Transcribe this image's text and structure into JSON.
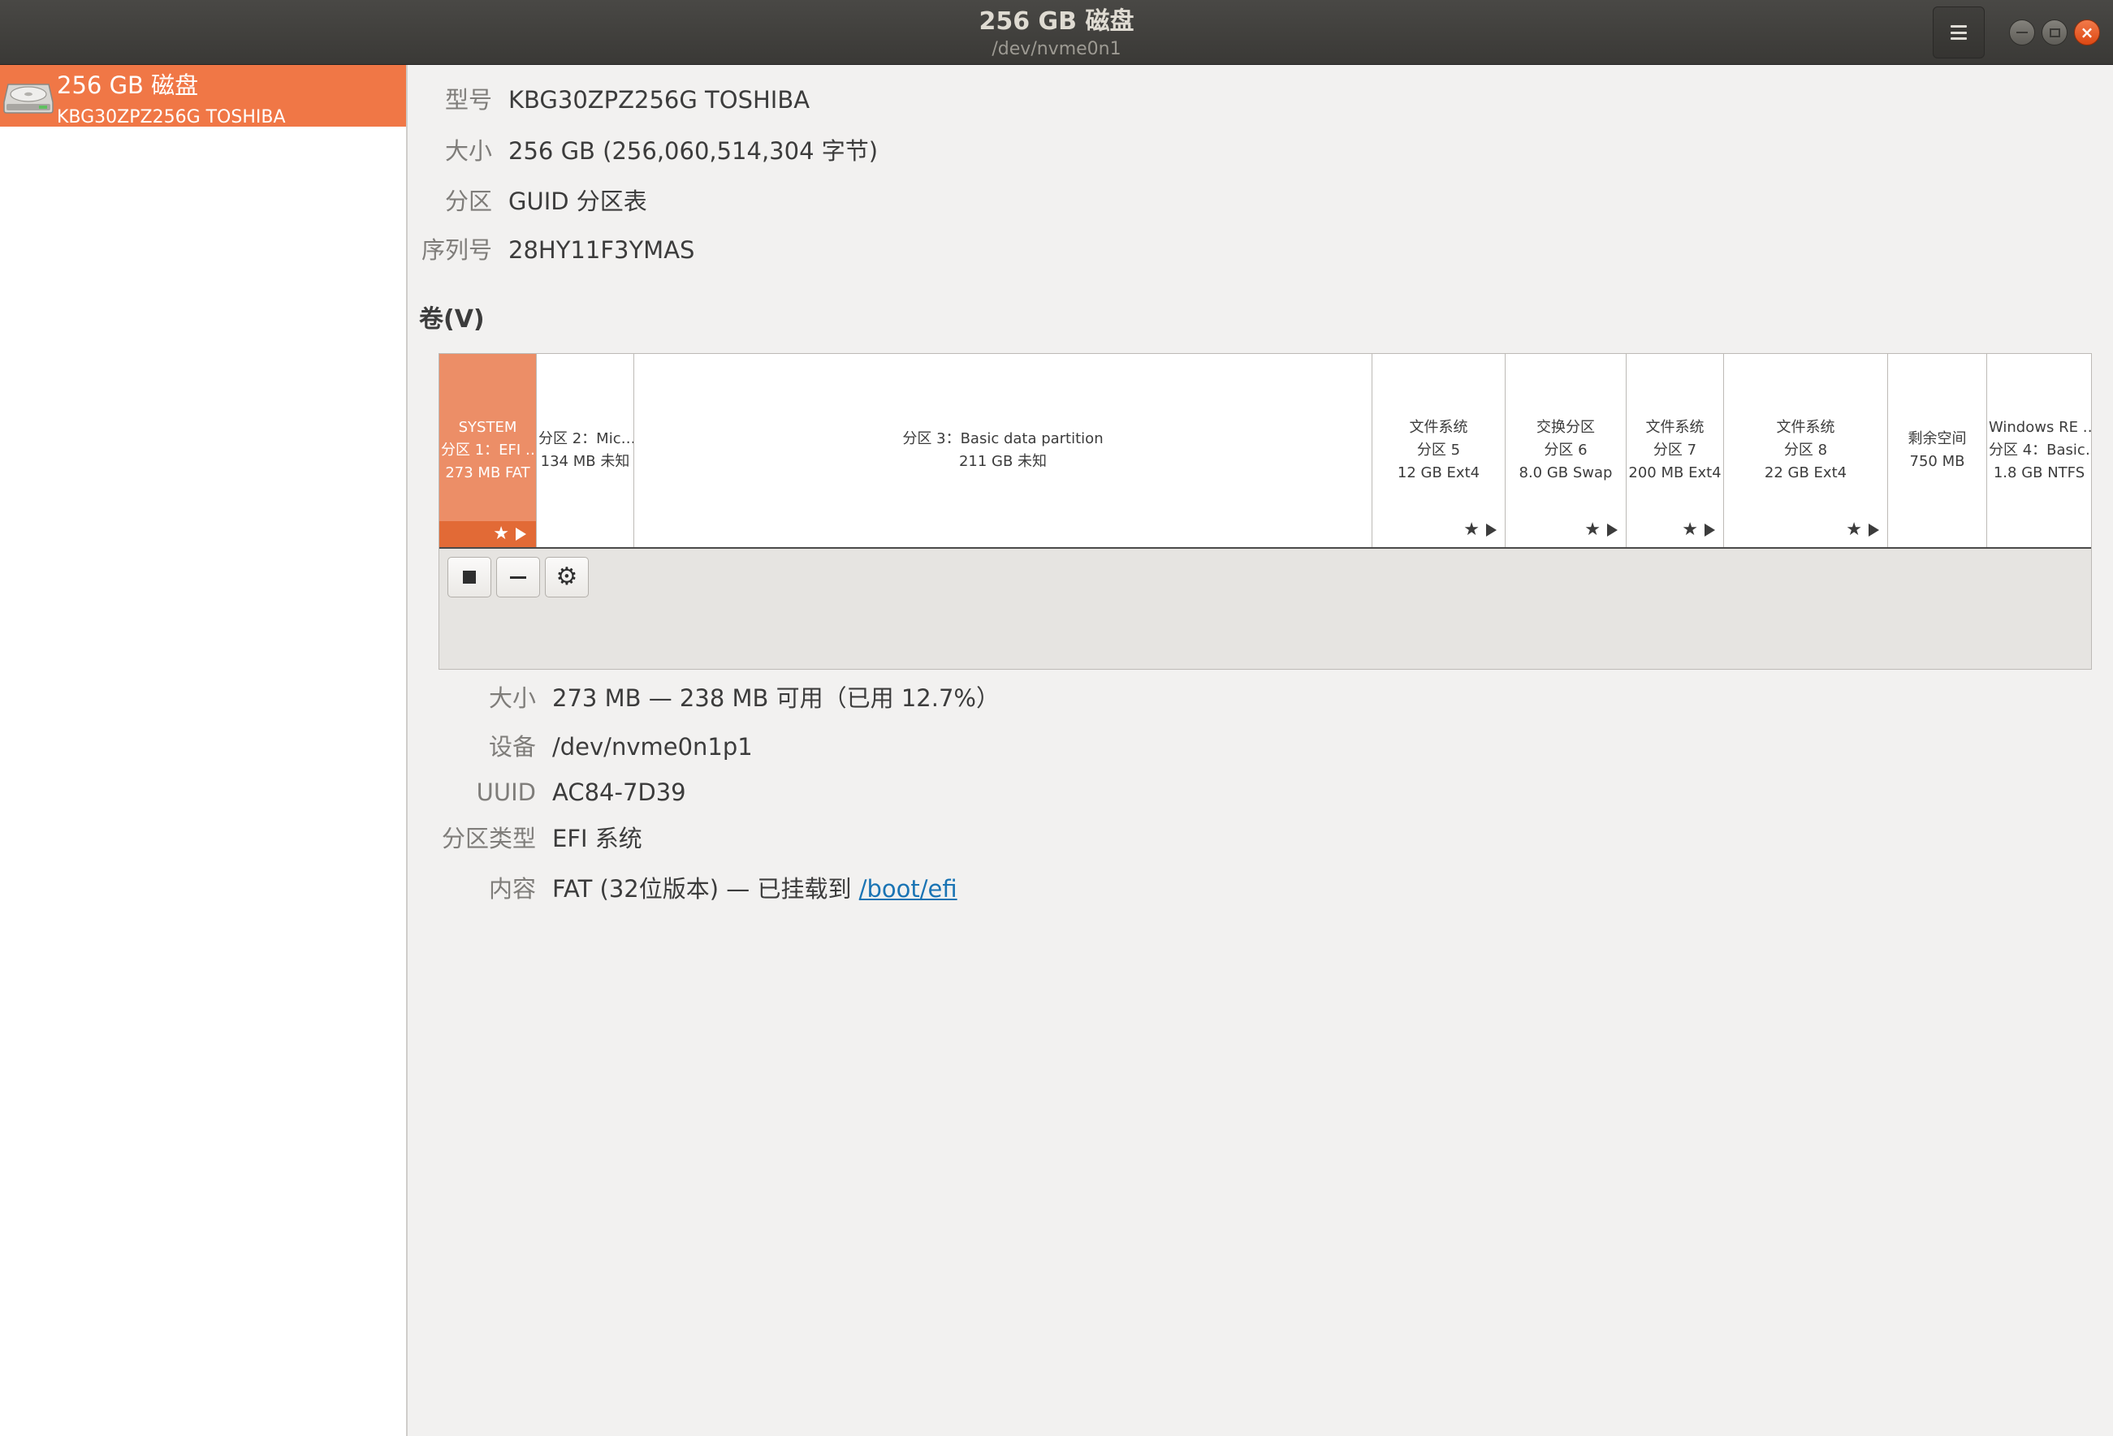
{
  "window": {
    "title": "256 GB 磁盘",
    "subtitle": "/dev/nvme0n1"
  },
  "sidebar": {
    "items": [
      {
        "title": "256 GB 磁盘",
        "subtitle": "KBG30ZPZ256G TOSHIBA",
        "selected": true,
        "icon": "disk-drive-icon"
      }
    ]
  },
  "disk_info": {
    "model_label": "型号",
    "model_value": "KBG30ZPZ256G TOSHIBA",
    "size_label": "大小",
    "size_value": "256 GB (256,060,514,304 字节)",
    "partition_label": "分区",
    "partition_value": "GUID 分区表",
    "serial_label": "序列号",
    "serial_value": "28HY11F3YMAS"
  },
  "volumes_heading": "卷(V)",
  "partitions": [
    {
      "l1": "SYSTEM",
      "l2": "分区 1：EFI …",
      "l3": "273 MB FAT",
      "selected": true
    },
    {
      "l1": "分区 2：Mic…",
      "l2": "134 MB 未知"
    },
    {
      "l1": "分区 3：Basic data partition",
      "l2": "211 GB 未知"
    },
    {
      "l1": "文件系统",
      "l2": "分区 5",
      "l3": "12 GB Ext4"
    },
    {
      "l1": "交换分区",
      "l2": "分区 6",
      "l3": "8.0 GB Swap"
    },
    {
      "l1": "文件系统",
      "l2": "分区 7",
      "l3": "200 MB Ext4"
    },
    {
      "l1": "文件系统",
      "l2": "分区 8",
      "l3": "22 GB Ext4"
    },
    {
      "l1": "剩余空间",
      "l2": "750 MB"
    },
    {
      "l1": "Windows RE …",
      "l2": "分区 4：Basic…",
      "l3": "1.8 GB NTFS"
    }
  ],
  "toolbar": {
    "stop_icon": "stop-icon",
    "delete_icon": "minus-icon",
    "settings_icon": "gears-icon",
    "gear_glyph": "⚙"
  },
  "marks": {
    "star": "★"
  },
  "selected_details": {
    "size_label": "大小",
    "size_value": "273 MB — 238 MB 可用（已用 12.7%）",
    "device_label": "设备",
    "device_value": "/dev/nvme0n1p1",
    "uuid_label": "UUID",
    "uuid_value": "AC84-7D39",
    "type_label": "分区类型",
    "type_value": "EFI 系统",
    "content_label": "内容",
    "content_value": "FAT (32位版本) — 已挂载到 ",
    "mount_link": "/boot/efi"
  },
  "colors": {
    "accent": "#f07746",
    "selected_partition": "#ec8e67",
    "titlebar": "#3f3e3b",
    "close_button": "#e85a22",
    "link": "#1a74b4"
  }
}
